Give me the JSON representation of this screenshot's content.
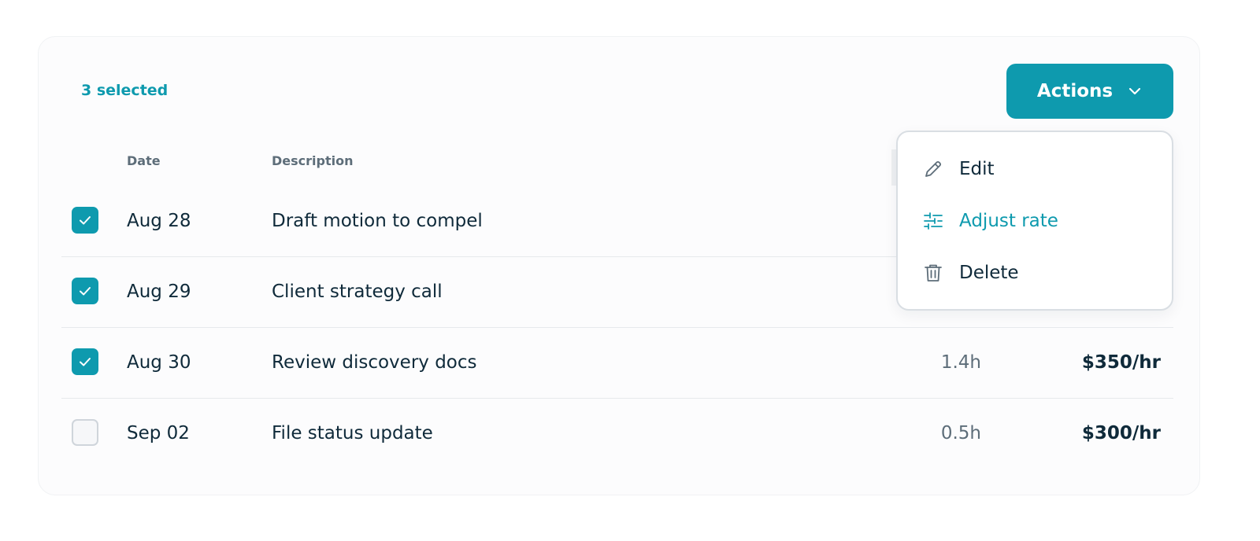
{
  "toolbar": {
    "selected_count": "3 selected",
    "actions_label": "Actions"
  },
  "table": {
    "columns": {
      "date": "Date",
      "description": "Description"
    },
    "rows": [
      {
        "checked": true,
        "date": "Aug 28",
        "description": "Draft motion to compel",
        "hours": "",
        "rate": ""
      },
      {
        "checked": true,
        "date": "Aug 29",
        "description": "Client strategy call",
        "hours": "",
        "rate": ""
      },
      {
        "checked": true,
        "date": "Aug 30",
        "description": "Review discovery docs",
        "hours": "1.4h",
        "rate": "$350/hr"
      },
      {
        "checked": false,
        "date": "Sep 02",
        "description": "File status update",
        "hours": "0.5h",
        "rate": "$300/hr"
      }
    ]
  },
  "menu": {
    "items": [
      {
        "label": "Edit",
        "icon": "pencil-icon"
      },
      {
        "label": "Adjust rate",
        "icon": "sliders-icon",
        "active": true
      },
      {
        "label": "Delete",
        "icon": "trash-icon"
      }
    ]
  },
  "colors": {
    "accent": "#0e9aae",
    "text": "#0f2a3a",
    "muted": "#5d6d79"
  }
}
